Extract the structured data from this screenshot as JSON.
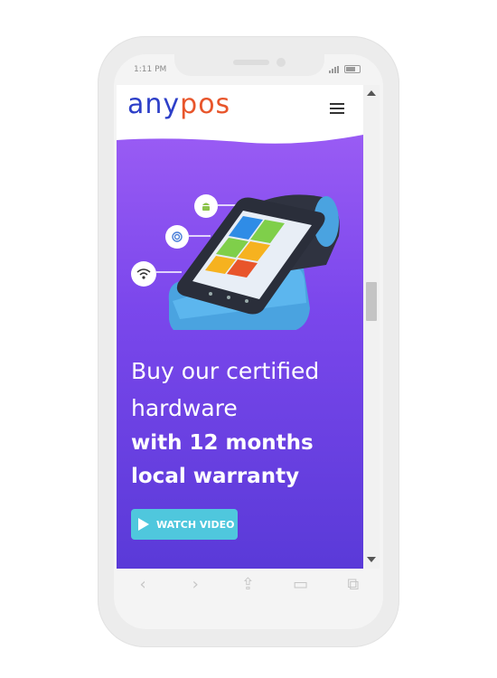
{
  "status_bar": {
    "time": "1:11 PM"
  },
  "header": {
    "logo_part1": "any",
    "logo_part2": "pos",
    "menu_icon": "hamburger-menu-icon"
  },
  "hero": {
    "headline_line1": "Buy our certified",
    "headline_line2": "hardware",
    "headline_line3": "with 12 months",
    "headline_line4": "local warranty",
    "cta_label": "WATCH VIDEO",
    "feature_icons": [
      "android-icon",
      "fingerprint-icon",
      "wifi-icon"
    ]
  },
  "browser_toolbar": {
    "back": "‹",
    "forward": "›",
    "share": "⇪",
    "bookmarks": "▭",
    "tabs": "⧉"
  },
  "colors": {
    "brand_blue": "#2d3fc8",
    "brand_red": "#e8552b",
    "hero_top": "#9a5cf4",
    "hero_bottom": "#5a3ad8",
    "cta": "#4fc7dd"
  }
}
